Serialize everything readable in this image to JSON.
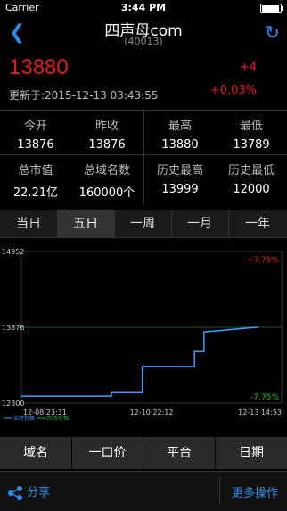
{
  "status_bar": {
    "carrier": "Carrier",
    "time": "3:44 PM"
  },
  "nav": {
    "title": "四声母com",
    "subtitle": "(40013)"
  },
  "quote": {
    "price": "13880",
    "updated": "更新于:2015-12-13 03:43:55",
    "change": "+4",
    "change_pct": "+0.03%"
  },
  "stats": {
    "row1": [
      {
        "label": "今开",
        "value": "13876"
      },
      {
        "label": "昨收",
        "value": "13876"
      },
      {
        "label": "最高",
        "value": "13880"
      },
      {
        "label": "最低",
        "value": "13789"
      }
    ],
    "row2": [
      {
        "label": "总市值",
        "value": "22.21亿"
      },
      {
        "label": "总域名数",
        "value": "160000个"
      },
      {
        "label": "历史最高",
        "value": "13999"
      },
      {
        "label": "历史最低",
        "value": "12000"
      }
    ]
  },
  "period_tabs": [
    "当日",
    "五日",
    "一周",
    "一月",
    "一年"
  ],
  "period_selected": "五日",
  "chart_data": {
    "type": "line",
    "series": [
      {
        "name": "实时价格",
        "color": "#3aa0ff"
      },
      {
        "name": "昨收价格",
        "color": "#22aa22"
      }
    ],
    "x_labels": [
      "12-08 23:31",
      "12-10 22:12",
      "12-13 14:53"
    ],
    "y_labels": [
      "14952",
      "13876",
      "12800"
    ],
    "ylim": [
      12800,
      14952
    ],
    "reference": 13876,
    "top_pct": "+7.75%",
    "bottom_pct": "-7.75%",
    "points": [
      [
        0,
        12900
      ],
      [
        0.38,
        12900
      ],
      [
        0.38,
        12950
      ],
      [
        0.51,
        12950
      ],
      [
        0.51,
        13320
      ],
      [
        0.73,
        13320
      ],
      [
        0.73,
        13530
      ],
      [
        0.77,
        13530
      ],
      [
        0.77,
        13810
      ],
      [
        1.0,
        13880
      ]
    ]
  },
  "bottom_tabs": [
    "域名",
    "一口价",
    "平台",
    "日期"
  ],
  "toolbar": {
    "share": "分享",
    "more": "更多操作"
  },
  "colors": {
    "accent": "#2b8de8",
    "up": "#e8191b",
    "down": "#1ec01e"
  }
}
